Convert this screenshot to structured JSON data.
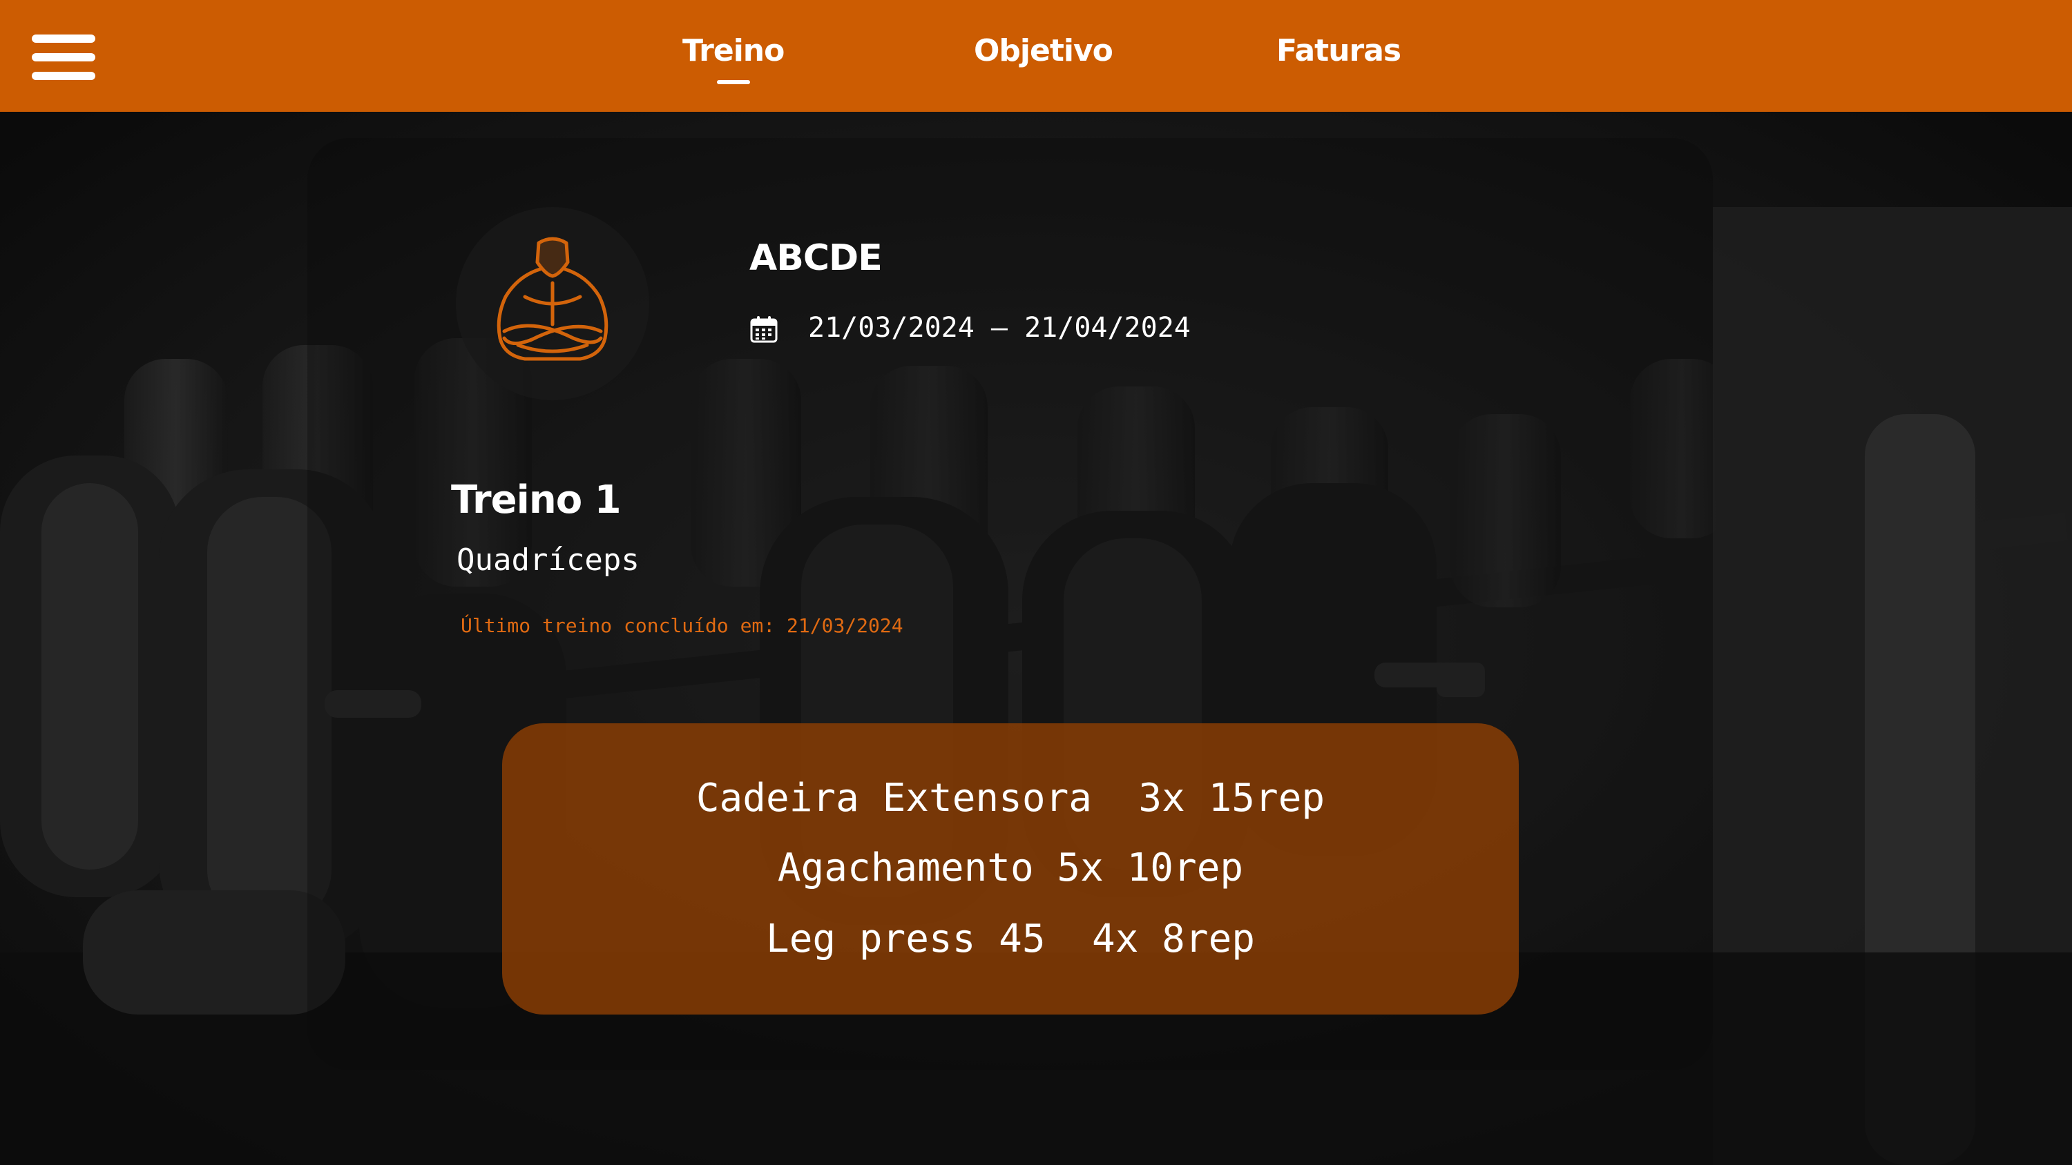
{
  "header": {
    "menu_icon": "hamburger-menu-icon",
    "tabs": [
      {
        "label": "Treino",
        "active": true
      },
      {
        "label": "Objetivo",
        "active": false
      },
      {
        "label": "Faturas",
        "active": false
      }
    ],
    "background_color": "#cc5c02"
  },
  "profile": {
    "avatar_icon": "bodybuilder-avatar-icon",
    "name": "ABCDE",
    "calendar_icon": "calendar-icon",
    "date_range": "21/03/2024 – 21/04/2024"
  },
  "workout": {
    "title": "Treino 1",
    "muscle_group": "Quadríceps",
    "last_completed": "Último treino concluído em: 21/03/2024",
    "exercises": [
      "Cadeira Extensora  3x 15rep",
      "Agachamento 5x 10rep",
      "Leg press 45  4x 8rep"
    ]
  },
  "colors": {
    "accent": "#cc5c02",
    "card": "#8c3e04",
    "highlight_text": "#e06a12"
  }
}
